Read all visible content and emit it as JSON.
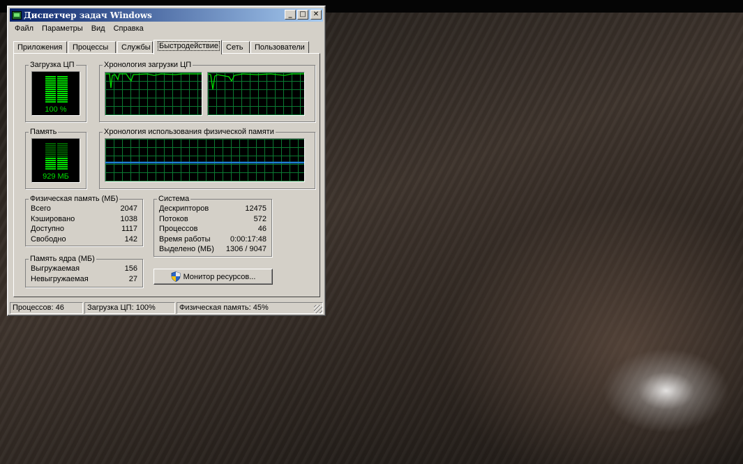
{
  "window": {
    "title": "Диспетчер задач Windows",
    "controls": {
      "minimize": "_",
      "maximize": "□",
      "close": "✕"
    }
  },
  "menu": [
    "Файл",
    "Параметры",
    "Вид",
    "Справка"
  ],
  "tabs": [
    "Приложения",
    "Процессы",
    "Службы",
    "Быстродействие",
    "Сеть",
    "Пользователи"
  ],
  "active_tab": "Быстродействие",
  "performance": {
    "cpu": {
      "group_label": "Загрузка ЦП",
      "value_text": "100 %",
      "level": 1.0
    },
    "cpu_history": {
      "group_label": "Хронология загрузки ЦП"
    },
    "memory": {
      "group_label": "Память",
      "value_text": "929 МБ",
      "level": 0.45
    },
    "memory_history": {
      "group_label": "Хронология использования физической памяти"
    },
    "physical_memory": {
      "group_label": "Физическая память (МБ)",
      "rows": [
        {
          "label": "Всего",
          "value": "2047"
        },
        {
          "label": "Кэшировано",
          "value": "1038"
        },
        {
          "label": "Доступно",
          "value": "1117"
        },
        {
          "label": "Свободно",
          "value": "142"
        }
      ]
    },
    "kernel_memory": {
      "group_label": "Память ядра (МБ)",
      "rows": [
        {
          "label": "Выгружаемая",
          "value": "156"
        },
        {
          "label": "Невыгружаемая",
          "value": "27"
        }
      ]
    },
    "system": {
      "group_label": "Система",
      "rows": [
        {
          "label": "Дескрипторов",
          "value": "12475"
        },
        {
          "label": "Потоков",
          "value": "572"
        },
        {
          "label": "Процессов",
          "value": "46"
        },
        {
          "label": "Время работы",
          "value": "0:00:17:48"
        },
        {
          "label": "Выделено (МБ)",
          "value": "1306 / 9047"
        }
      ]
    },
    "resource_monitor_button": "Монитор ресурсов..."
  },
  "statusbar": {
    "processes": "Процессов: 46",
    "cpu": "Загрузка ЦП: 100%",
    "memory": "Физическая память: 45%"
  },
  "colors": {
    "titlebar_start": "#0a246a",
    "titlebar_end": "#a6caf0",
    "meter_green": "#00e000",
    "graph_grid": "#0b7a32",
    "memory_line": "#1e7fd6"
  }
}
